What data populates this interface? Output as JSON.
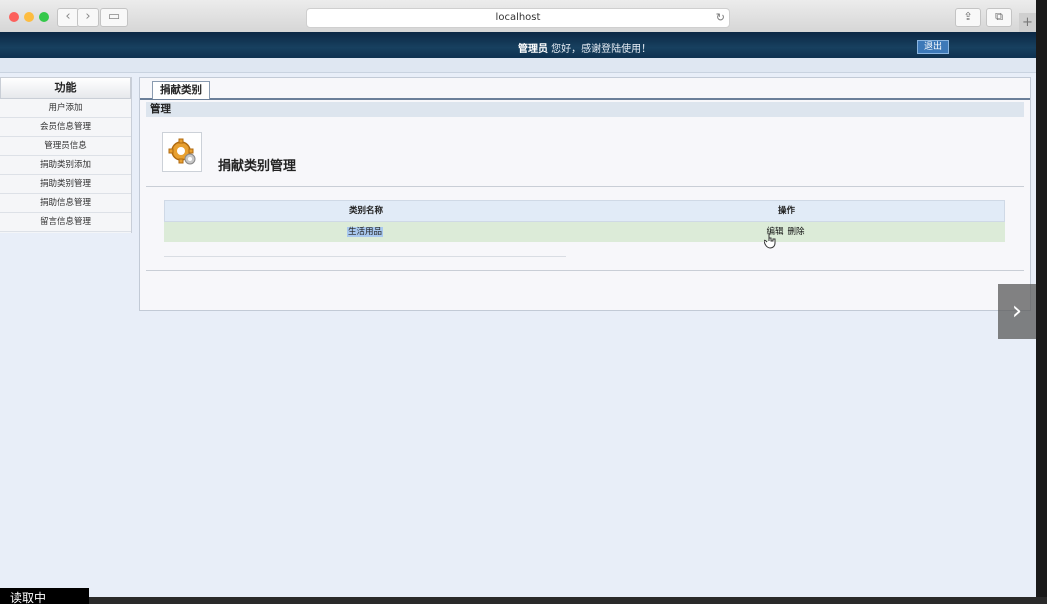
{
  "browser": {
    "address": "localhost",
    "reload_icon": "↻",
    "back_icon": "‹",
    "forward_icon": "›",
    "sidebar_icon": "▭",
    "share_icon": "⇪",
    "tabs_icon": "⧉",
    "new_tab_icon": "+"
  },
  "header": {
    "user": "管理员",
    "welcome_text": " 您好，感谢登陆使用！",
    "logout_label": "退出"
  },
  "sidebar": {
    "title": "功能",
    "items": [
      {
        "label": "用户添加"
      },
      {
        "label": "会员信息管理"
      },
      {
        "label": "管理员信息"
      },
      {
        "label": "捐助类别添加"
      },
      {
        "label": "捐助类别管理"
      },
      {
        "label": "捐助信息管理"
      },
      {
        "label": "留言信息管理"
      }
    ]
  },
  "main": {
    "tab_label": "捐献类别",
    "section_label": "管理",
    "page_title": "捐献类别管理",
    "table": {
      "headers": [
        "类别名称",
        "操作"
      ],
      "rows": [
        {
          "name": "生活用品",
          "edit": "编辑",
          "delete": "删除"
        }
      ]
    }
  },
  "overlay": {
    "next_icon": "›",
    "status_text": "读取中"
  },
  "colors": {
    "topbar": "#17405f",
    "selected_row": "#dcebd8",
    "header_row": "#e1ebf7"
  }
}
